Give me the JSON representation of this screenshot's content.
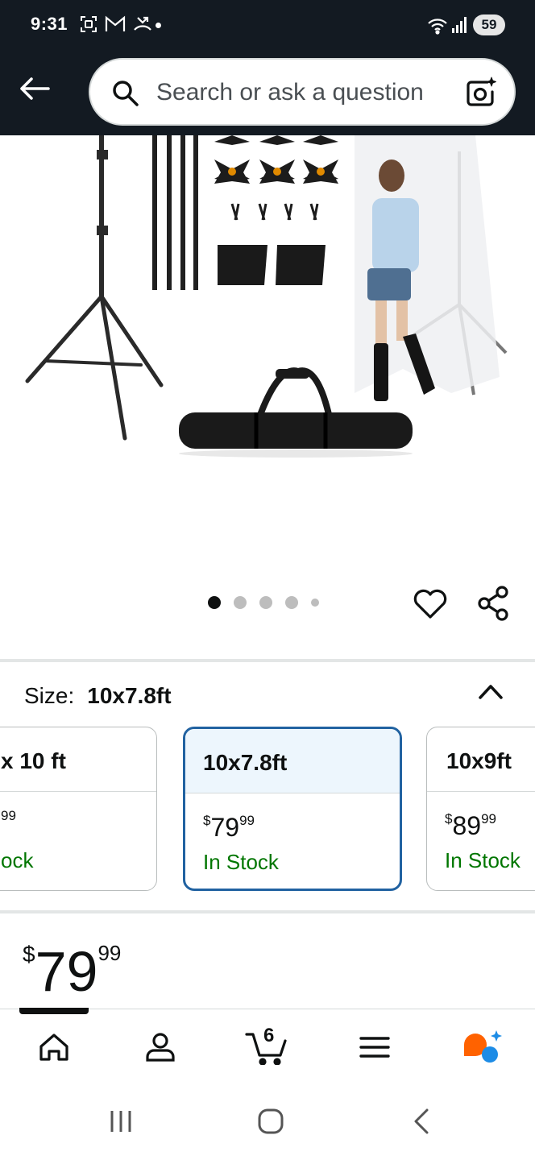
{
  "status_bar": {
    "time": "9:31",
    "battery": "59"
  },
  "search": {
    "placeholder": "Search or ask a question"
  },
  "gallery": {
    "total_images": 5,
    "active_index": 1
  },
  "size_selector": {
    "label": "Size:",
    "selected_value": "10x7.8ft",
    "options": [
      {
        "title": "x 10 ft",
        "price_whole": "",
        "price_frac": "99",
        "stock": "ock"
      },
      {
        "title": "10x7.8ft",
        "price_whole": "79",
        "price_frac": "99",
        "currency": "$",
        "stock": "In Stock"
      },
      {
        "title": "10x9ft",
        "price_whole": "89",
        "price_frac": "99",
        "currency": "$",
        "stock": "In Stock"
      }
    ]
  },
  "price": {
    "currency": "$",
    "whole": "79",
    "fraction": "99"
  },
  "bottom_nav": {
    "cart_count": "6"
  },
  "colors": {
    "header_bg": "#131a22",
    "selected_border": "#2162a1",
    "in_stock": "#007600",
    "rufus_orange": "#ff6200",
    "rufus_blue": "#1d8ce6"
  }
}
